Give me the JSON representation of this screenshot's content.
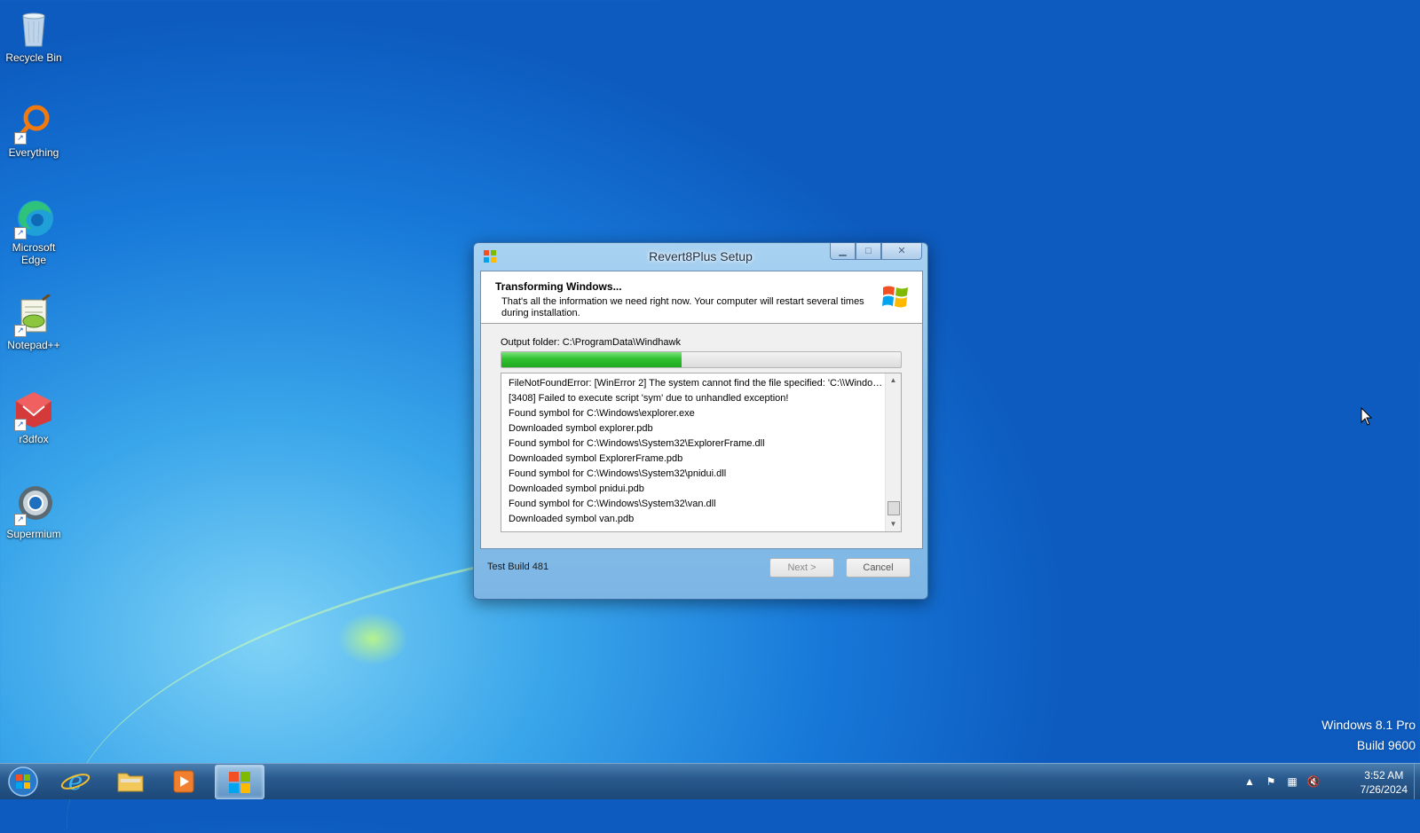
{
  "desktop": {
    "icons": [
      {
        "label": "Recycle Bin",
        "icon": "recycle-bin-icon"
      },
      {
        "label": "Everything",
        "icon": "everything-search-icon"
      },
      {
        "label": "Microsoft Edge",
        "icon": "edge-icon"
      },
      {
        "label": "Notepad++",
        "icon": "notepadpp-icon"
      },
      {
        "label": "r3dfox",
        "icon": "r3dfox-icon"
      },
      {
        "label": "Supermium",
        "icon": "supermium-icon"
      }
    ],
    "watermark": {
      "line1": "Windows 8.1 Pro",
      "line2": "Build 9600"
    }
  },
  "dialog": {
    "title": "Revert8Plus Setup",
    "header": {
      "title": "Transforming Windows...",
      "subtitle": "That's all the information we need right now. Your computer will restart several times during installation."
    },
    "output_folder": "Output folder: C:\\ProgramData\\Windhawk",
    "progress": 0.45,
    "log": [
      "FileNotFoundError: [WinError 2] The system cannot find the file specified: 'C:\\\\Windows\\\\System32\\\\...",
      "[3408] Failed to execute script 'sym' due to unhandled exception!",
      "Found symbol for C:\\Windows\\explorer.exe",
      "Downloaded symbol explorer.pdb",
      "Found symbol for C:\\Windows\\System32\\ExplorerFrame.dll",
      "Downloaded symbol ExplorerFrame.pdb",
      "Found symbol for C:\\Windows\\System32\\pnidui.dll",
      "Downloaded symbol pnidui.pdb",
      "Found symbol for C:\\Windows\\System32\\van.dll",
      "Downloaded symbol van.pdb"
    ],
    "footer": {
      "build_label": "Test Build 481",
      "next_label": "Next >",
      "cancel_label": "Cancel"
    }
  },
  "taskbar": {
    "clock": {
      "time": "3:52 AM",
      "date": "7/26/2024"
    },
    "pinned": [
      "internet-explorer-icon",
      "file-explorer-icon",
      "media-player-icon",
      "revert8plus-setup-icon"
    ]
  },
  "colors": {
    "progress_green": "#2fc12f",
    "taskbar": "#2a5a8e",
    "desktop_blue": "#1778d8"
  }
}
